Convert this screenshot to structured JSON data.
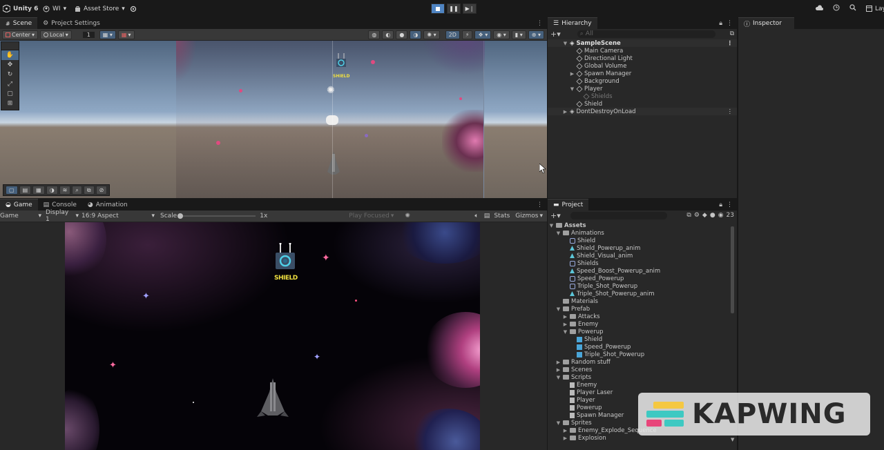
{
  "topbar": {
    "app_name": "Unity 6",
    "account": "WI",
    "asset_store": "Asset Store",
    "layout": "Lay"
  },
  "scene_panel": {
    "tabs": [
      {
        "label": "Scene"
      },
      {
        "label": "Project Settings"
      }
    ],
    "pivot": "Center",
    "space": "Local",
    "grid_value": "1",
    "mode_2d": "2D"
  },
  "game_panel": {
    "tabs": [
      {
        "label": "Game"
      },
      {
        "label": "Console"
      },
      {
        "label": "Animation"
      }
    ],
    "view_select": "Game",
    "display": "Display 1",
    "aspect": "16:9 Aspect",
    "scale_label": "Scale",
    "scale_value": "1x",
    "play_focused": "Play Focused",
    "stats": "Stats",
    "gizmos": "Gizmos"
  },
  "hierarchy": {
    "tab": "Hierarchy",
    "search_placeholder": "All",
    "items": [
      {
        "label": "SampleScene"
      },
      {
        "label": "Main Camera"
      },
      {
        "label": "Directional Light"
      },
      {
        "label": "Global Volume"
      },
      {
        "label": "Spawn Manager"
      },
      {
        "label": "Background"
      },
      {
        "label": "Player"
      },
      {
        "label": "Shields"
      },
      {
        "label": "Shield"
      },
      {
        "label": "DontDestroyOnLoad"
      }
    ]
  },
  "inspector": {
    "tab": "Inspector"
  },
  "project": {
    "tab": "Project",
    "hidden_count": "23",
    "tree": [
      {
        "label": "Assets"
      },
      {
        "label": "Animations"
      },
      {
        "label": "Shield"
      },
      {
        "label": "Shield_Powerup_anim"
      },
      {
        "label": "Shield_Visual_anim"
      },
      {
        "label": "Shields"
      },
      {
        "label": "Speed_Boost_Powerup_anim"
      },
      {
        "label": "Speed_Powerup"
      },
      {
        "label": "Triple_Shot_Powerup"
      },
      {
        "label": "Triple_Shot_Powerup_anim"
      },
      {
        "label": "Materials"
      },
      {
        "label": "Prefab"
      },
      {
        "label": "Attacks"
      },
      {
        "label": "Enemy"
      },
      {
        "label": "Powerup"
      },
      {
        "label": "Shield"
      },
      {
        "label": "Speed_Powerup"
      },
      {
        "label": "Triple_Shot_Powerup"
      },
      {
        "label": "Random stuff"
      },
      {
        "label": "Scenes"
      },
      {
        "label": "Scripts"
      },
      {
        "label": "Enemy"
      },
      {
        "label": "Player Laser"
      },
      {
        "label": "Player"
      },
      {
        "label": "Powerup"
      },
      {
        "label": "Spawn Manager"
      },
      {
        "label": "Sprites"
      },
      {
        "label": "Enemy_Explode_Sequence"
      },
      {
        "label": "Explosion"
      }
    ]
  },
  "game": {
    "shield_label": "SHIELD"
  },
  "watermark": {
    "text": "KAPWING"
  },
  "colors": {
    "accent": "#4f84c2",
    "panel_bg": "#282828",
    "toolbar_bg": "#383838",
    "kapwing_yellow": "#f5c842",
    "kapwing_pink": "#e8457a",
    "kapwing_teal": "#3ec9c2"
  }
}
